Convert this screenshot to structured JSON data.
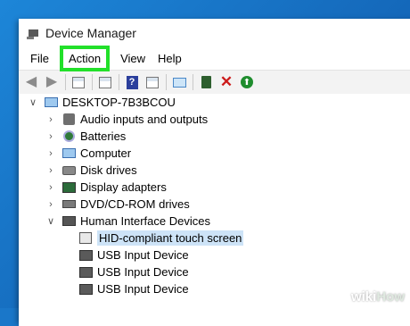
{
  "window": {
    "title": "Device Manager",
    "app_icon": "device-manager-icon"
  },
  "menu": {
    "file": "File",
    "action": "Action",
    "view": "View",
    "help": "Help"
  },
  "toolbar": {
    "help_glyph": "?",
    "remove_glyph": "✕",
    "update_glyph": "⬆"
  },
  "tree": {
    "root": "DESKTOP-7B3BCOU",
    "categories": [
      {
        "label": "Audio inputs and outputs",
        "icon": "speaker-icon",
        "expanded": false
      },
      {
        "label": "Batteries",
        "icon": "battery-icon",
        "expanded": false
      },
      {
        "label": "Computer",
        "icon": "computer-icon",
        "expanded": false
      },
      {
        "label": "Disk drives",
        "icon": "disk-drive-icon",
        "expanded": false
      },
      {
        "label": "Display adapters",
        "icon": "display-adapter-icon",
        "expanded": false
      },
      {
        "label": "DVD/CD-ROM drives",
        "icon": "dvd-drive-icon",
        "expanded": false
      },
      {
        "label": "Human Interface Devices",
        "icon": "hid-icon",
        "expanded": true
      }
    ],
    "hid_children": [
      {
        "label": "HID-compliant touch screen",
        "icon": "touch-screen-icon",
        "selected": true
      },
      {
        "label": "USB Input Device",
        "icon": "usb-device-icon",
        "selected": false
      },
      {
        "label": "USB Input Device",
        "icon": "usb-device-icon",
        "selected": false
      },
      {
        "label": "USB Input Device",
        "icon": "usb-device-icon",
        "selected": false
      }
    ]
  },
  "watermark": {
    "wiki": "wiki",
    "how": "How"
  },
  "colors": {
    "highlight_box": "#22e02a",
    "selection": "#cde3f7",
    "desktop": "#1a77c9"
  }
}
